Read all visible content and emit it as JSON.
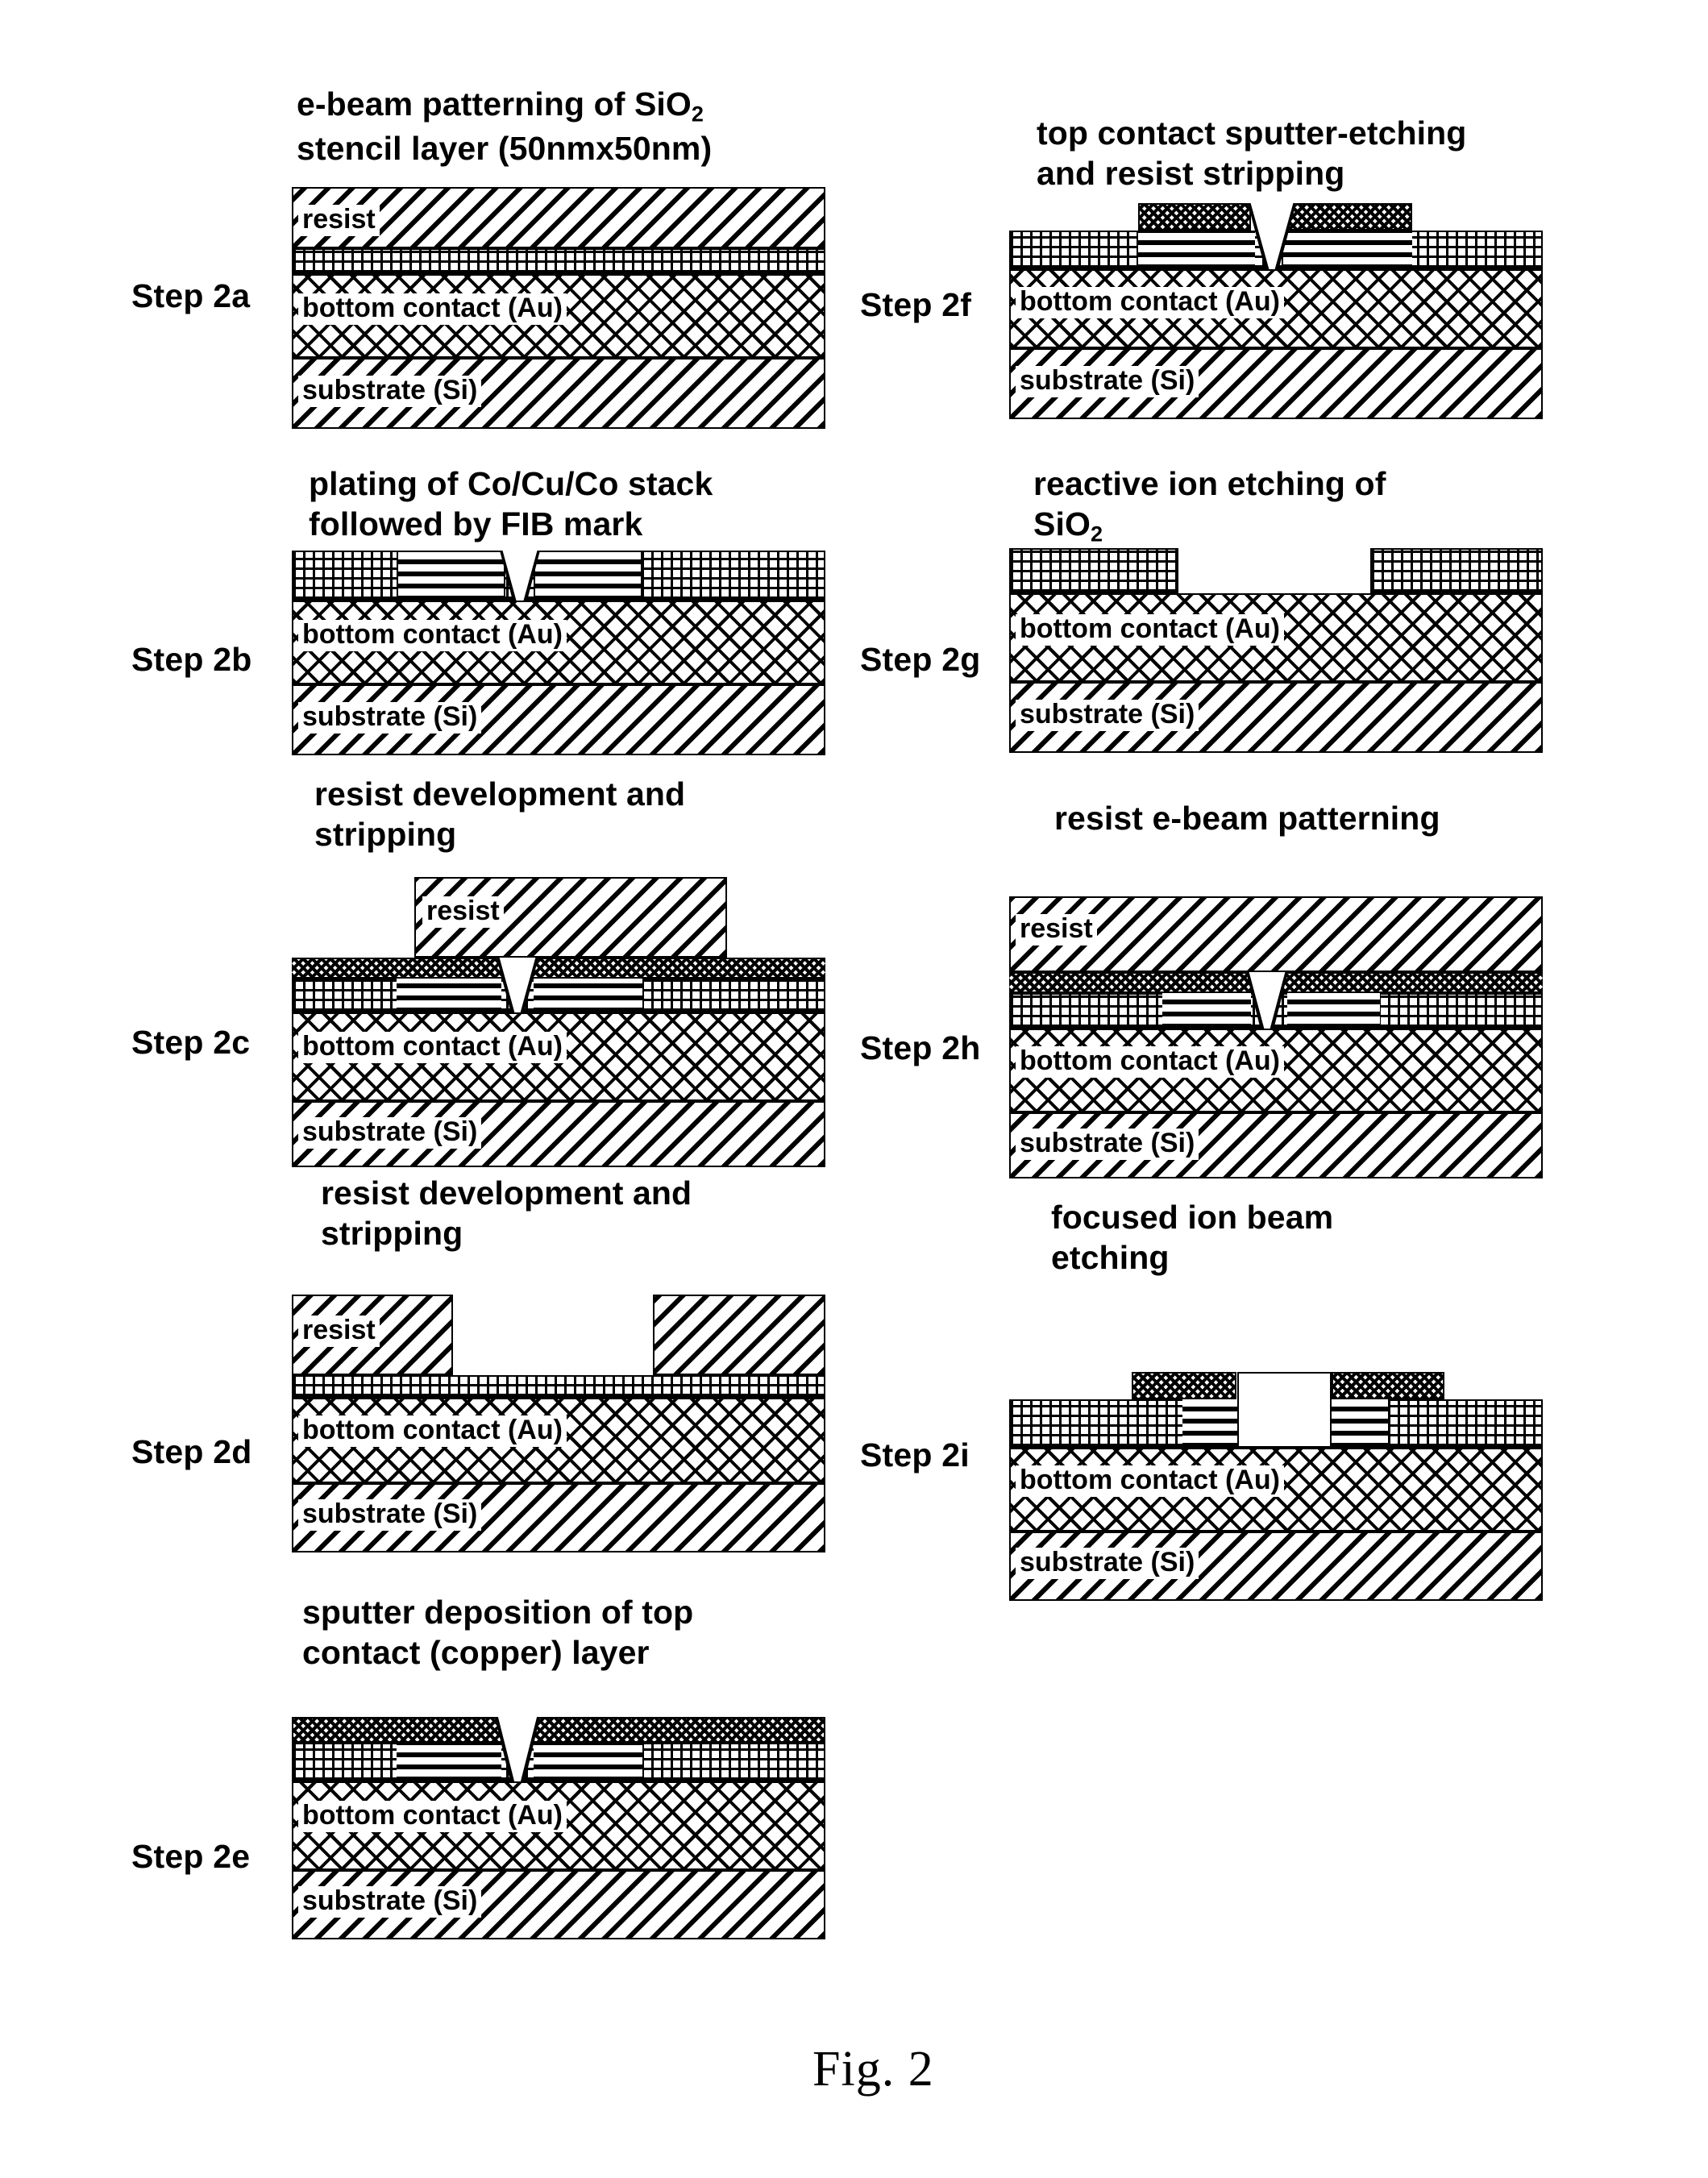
{
  "figure": {
    "caption": "Fig. 2"
  },
  "materials": {
    "resist": "resist",
    "bottom_contact": "bottom contact (Au)",
    "substrate": "substrate (Si)"
  },
  "steps": [
    {
      "id": "2a",
      "step_label": "Step 2a",
      "title_line1": "e-beam patterning of SiO",
      "title_sub1": "2",
      "title_line2": "stencil layer (50nmx50nm)",
      "layer_labels": [
        "resist",
        "bottom contact (Au)",
        "substrate (Si)"
      ]
    },
    {
      "id": "2b",
      "step_label": "Step 2b",
      "title_line1": "plating of Co/Cu/Co stack",
      "title_sub1": "",
      "title_line2": "followed by FIB mark",
      "layer_labels": [
        "bottom contact (Au)",
        "substrate (Si)"
      ]
    },
    {
      "id": "2c",
      "step_label": "Step 2c",
      "title_line1": "resist development and",
      "title_sub1": "",
      "title_line2": "stripping",
      "layer_labels": [
        "resist",
        "bottom contact (Au)",
        "substrate (Si)"
      ]
    },
    {
      "id": "2d",
      "step_label": "Step 2d",
      "title_line1": "resist development and",
      "title_sub1": "",
      "title_line2": "stripping",
      "layer_labels": [
        "resist",
        "bottom contact (Au)",
        "substrate (Si)"
      ]
    },
    {
      "id": "2e",
      "step_label": "Step 2e",
      "title_line1": "sputter deposition of top",
      "title_sub1": "",
      "title_line2": "contact (copper) layer",
      "layer_labels": [
        "bottom contact (Au)",
        "substrate (Si)"
      ]
    },
    {
      "id": "2f",
      "step_label": "Step 2f",
      "title_line1": "top contact sputter-etching",
      "title_sub1": "",
      "title_line2": "and resist stripping",
      "layer_labels": [
        "bottom contact (Au)",
        "substrate (Si)"
      ]
    },
    {
      "id": "2g",
      "step_label": "Step 2g",
      "title_line1": "reactive ion etching of",
      "title_line2": "SiO",
      "title_sub2": "2",
      "layer_labels": [
        "bottom contact (Au)",
        "substrate (Si)"
      ]
    },
    {
      "id": "2h",
      "step_label": "Step 2h",
      "title_line1": "resist e-beam patterning",
      "title_sub1": "",
      "title_line2": "",
      "layer_labels": [
        "resist",
        "bottom contact (Au)",
        "substrate (Si)"
      ]
    },
    {
      "id": "2i",
      "step_label": "Step 2i",
      "title_line1": "focused ion beam",
      "title_sub1": "",
      "title_line2": "etching",
      "layer_labels": [
        "bottom contact (Au)",
        "substrate (Si)"
      ]
    }
  ]
}
